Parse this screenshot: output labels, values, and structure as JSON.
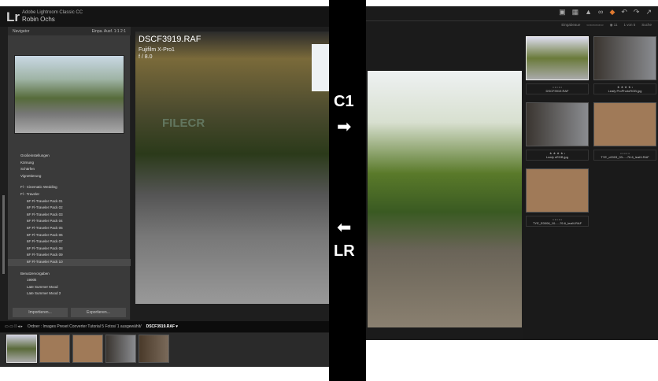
{
  "lightroom": {
    "logo": "Lr",
    "app_name": "Adobe Lightroom Classic CC",
    "user": "Robin Ochs",
    "navigator": {
      "title": "Navigator",
      "zoom_options": [
        "Einpa.",
        "Ausf.",
        "1:1",
        "2:1"
      ]
    },
    "presets": [
      {
        "label": "Großeinstellungen",
        "level": 0
      },
      {
        "label": "Körnung",
        "level": 0
      },
      {
        "label": "Schärfen",
        "level": 0
      },
      {
        "label": "Vignettierung",
        "level": 0
      },
      {
        "label": "Fl - Cinematic Wedding",
        "level": 0
      },
      {
        "label": "Fl - Traveler",
        "level": 0
      },
      {
        "label": "6F Fl-Traveler Pack 01",
        "level": 1
      },
      {
        "label": "6F Fl-Traveler Pack 02",
        "level": 1
      },
      {
        "label": "6F Fl-Traveler Pack 03",
        "level": 1
      },
      {
        "label": "6F Fl-Traveler Pack 04",
        "level": 1
      },
      {
        "label": "6F Fl-Traveler Pack 05",
        "level": 1
      },
      {
        "label": "6F Fl-Traveler Pack 06",
        "level": 1
      },
      {
        "label": "6F Fl-Traveler Pack 07",
        "level": 1
      },
      {
        "label": "6F Fl-Traveler Pack 08",
        "level": 1
      },
      {
        "label": "6F Fl-Traveler Pack 09",
        "level": 1
      },
      {
        "label": "6F Fl-Traveler Pack 10",
        "level": 1
      },
      {
        "label": "Benutzervorgaben",
        "level": 0
      },
      {
        "label": "1900k",
        "level": 1
      },
      {
        "label": "Late Summer Mood",
        "level": 1
      },
      {
        "label": "Late Summer Mood 2",
        "level": 1
      }
    ],
    "import_label": "Importieren...",
    "export_label": "Exportieren...",
    "photo": {
      "filename": "DSCF3919.RAF",
      "camera": "Fujifilm X-Pro1",
      "aperture": "f / 8.0"
    },
    "watermark": "FILECR",
    "filmstrip_path": "Ordner : Images Preset Converter Tutorial  5 Fotos/ 1 ausgewählt/",
    "filmstrip_selected": "DSCF3919.RAF ▾"
  },
  "overlay": {
    "c1_label": "C1",
    "lr_label": "LR",
    "arrow_right": "➡",
    "arrow_left": "⬅"
  },
  "captureone": {
    "toolbar_icons": [
      "▣",
      "▦",
      "▲",
      "∞",
      "◆",
      "↶",
      "↷",
      "↗"
    ],
    "bar": [
      "Eingabeaue",
      "▭▭▭▭▭",
      "◉ 11",
      "1 von 5",
      "Suche"
    ],
    "thumbs": [
      {
        "name": "DSCF3919.RAF",
        "stars": "• • • • •"
      },
      {
        "name": "Leafy ProPhotoRGB.jpg",
        "stars": "★ ★ ★ ★ •"
      },
      {
        "name": "Leafy sRGB.jpg",
        "stars": "★ ★ ★ ★ •"
      },
      {
        "name": "TYE_c0003_03-...-76.6_leaf4.RAF",
        "stars": "• • • • •"
      },
      {
        "name": "TYE_E0006_10-...-76.6_leaf4.RAF",
        "stars": "• • • • •"
      }
    ]
  }
}
